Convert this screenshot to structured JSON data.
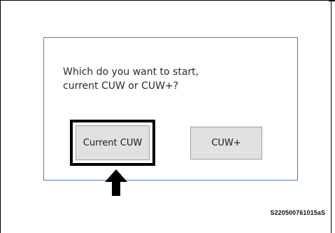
{
  "dialog": {
    "prompt_line1": "Which do you want to start,",
    "prompt_line2": "current CUW or CUW+?",
    "buttons": [
      {
        "label": "Current CUW",
        "highlighted": true
      },
      {
        "label": "CUW+",
        "highlighted": false
      }
    ]
  },
  "annotation": {
    "arrow_icon": "up-arrow-icon",
    "figure_code": "S220500761015aS"
  },
  "colors": {
    "dialog_border": "#4d7fb4",
    "button_face": "#e1e1e1",
    "highlight_frame": "#000000"
  }
}
